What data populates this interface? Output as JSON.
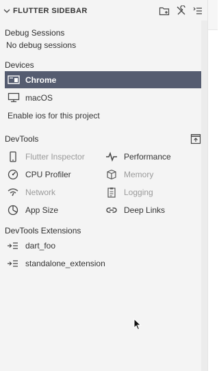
{
  "header": {
    "title": "FLUTTER SIDEBAR",
    "icons": [
      "new-folder-icon",
      "tools-icon",
      "collapse-list-icon"
    ]
  },
  "debug_sessions": {
    "title": "Debug Sessions",
    "empty_text": "No debug sessions"
  },
  "devices": {
    "title": "Devices",
    "items": [
      {
        "label": "Chrome",
        "icon": "browser-icon",
        "selected": true
      },
      {
        "label": "macOS",
        "icon": "desktop-icon",
        "selected": false
      }
    ],
    "enable_link": "Enable ios for this project"
  },
  "devtools": {
    "title": "DevTools",
    "open_icon": "open-in-window-icon",
    "tools": [
      {
        "label": "Flutter Inspector",
        "icon": "phone-icon",
        "enabled": false
      },
      {
        "label": "Performance",
        "icon": "pulse-icon",
        "enabled": true
      },
      {
        "label": "CPU Profiler",
        "icon": "speedometer-icon",
        "enabled": true
      },
      {
        "label": "Memory",
        "icon": "box-icon",
        "enabled": false
      },
      {
        "label": "Network",
        "icon": "wifi-icon",
        "enabled": false
      },
      {
        "label": "Logging",
        "icon": "clipboard-icon",
        "enabled": false
      },
      {
        "label": "App Size",
        "icon": "pie-chart-icon",
        "enabled": true
      },
      {
        "label": "Deep Links",
        "icon": "link-icon",
        "enabled": true
      }
    ]
  },
  "extensions": {
    "title": "DevTools Extensions",
    "items": [
      {
        "label": "dart_foo",
        "icon": "extension-list-icon"
      },
      {
        "label": "standalone_extension",
        "icon": "extension-list-icon"
      }
    ]
  },
  "colors": {
    "panel_bg": "#f4f4f4",
    "selected_bg": "#555c70",
    "text": "#333333",
    "disabled_text": "#9a9a9a"
  }
}
